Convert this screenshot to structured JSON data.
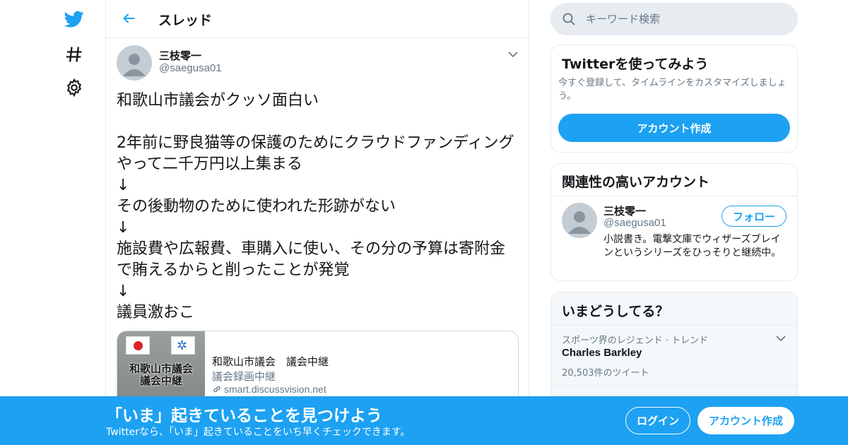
{
  "colors": {
    "accent": "#1da1f2",
    "text": "#14171a",
    "secondary": "#657786",
    "border": "#e6ecf0"
  },
  "nav": {
    "icons": [
      "twitter-bird-icon",
      "hashtag-icon",
      "gear-icon"
    ]
  },
  "header": {
    "title": "スレッド",
    "back_icon": "arrow-left-icon"
  },
  "tweet": {
    "name": "三枝零一",
    "handle": "@saegusa01",
    "text": "和歌山市議会がクッソ面白い\n\n2年前に野良猫等の保護のためにクラウドファンディングやって二千万円以上集まる\n↓\nその後動物のために使われた形跡がない\n↓\n施設費や広報費、車購入に使い、その分の予算は寄附金で賄えるからと削ったことが発覚\n↓\n議員激おこ",
    "card": {
      "thumb_text": "和歌山市議会\n議会中継",
      "title": "和歌山市議会　議会中継",
      "description": "議会録画中継",
      "domain": "smart.discussvision.net"
    }
  },
  "search": {
    "placeholder": "キーワード検索"
  },
  "signup_box": {
    "title": "Twitterを使ってみよう",
    "subtitle": "今すぐ登録して、タイムラインをカスタマイズしましょう。",
    "button": "アカウント作成"
  },
  "related": {
    "title": "関連性の高いアカウント",
    "name": "三枝零一",
    "handle": "@saegusa01",
    "follow": "フォロー",
    "bio": "小説書き。電撃文庫でウィザーズブレインというシリーズをひっそりと継続中。"
  },
  "trends": {
    "title": "いまどうしてる？",
    "items": [
      {
        "category": "スポーツ界のレジェンド · トレンド",
        "name": "Charles Barkley",
        "count": "20,503件のツイート"
      }
    ]
  },
  "banner": {
    "title": "「いま」起きていることを見つけよう",
    "subtitle": "Twitterなら、「いま」起きていることをいち早くチェックできます。",
    "login": "ログイン",
    "signup": "アカウント作成"
  }
}
